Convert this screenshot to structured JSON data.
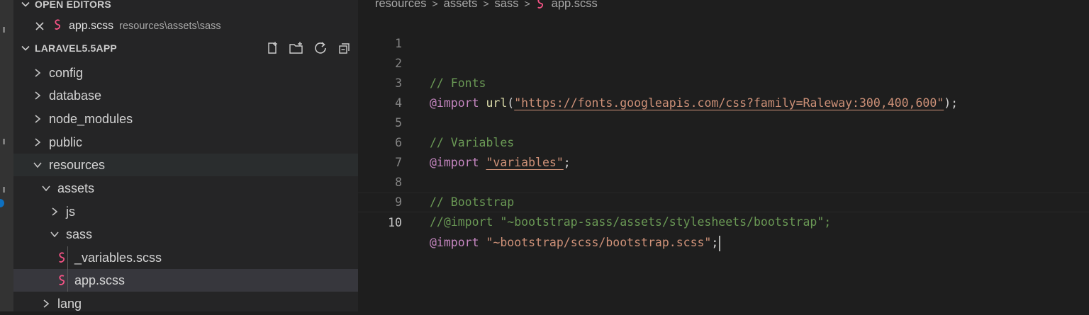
{
  "open_editors": {
    "header": "OPEN EDITORS",
    "items": [
      {
        "name": "app.scss",
        "path": "resources\\assets\\sass"
      }
    ]
  },
  "project": {
    "name": "LARAVEL5.5APP",
    "actions": [
      "new-file-icon",
      "new-folder-icon",
      "refresh-icon",
      "collapse-all-icon"
    ]
  },
  "tree": {
    "config": "config",
    "database": "database",
    "node_modules": "node_modules",
    "public": "public",
    "resources": "resources",
    "assets": "assets",
    "js": "js",
    "sass": "sass",
    "variables_file": "_variables.scss",
    "app_file": "app.scss",
    "lang": "lang"
  },
  "breadcrumb": {
    "parts": [
      "resources",
      "assets",
      "sass"
    ],
    "file": "app.scss"
  },
  "editor": {
    "line_numbers": [
      "1",
      "2",
      "3",
      "4",
      "5",
      "6",
      "7",
      "8",
      "9",
      "10"
    ],
    "lines": {
      "l2_comment": "// Fonts",
      "l3_at": "@import",
      "l3_fn": "url",
      "l3_open": "(",
      "l3_str": "\"https://fonts.googleapis.com/css?family=Raleway:300,400,600\"",
      "l3_close": ");",
      "l5_comment": "// Variables",
      "l6_at": "@import",
      "l6_str": "\"variables\"",
      "l6_end": ";",
      "l8_comment": "// Bootstrap",
      "l9_comment": "//@import \"~bootstrap-sass/assets/stylesheets/bootstrap\";",
      "l10_at": "@import",
      "l10_str": "\"~bootstrap/scss/bootstrap.scss\"",
      "l10_end": ";"
    }
  },
  "colors": {
    "sidebar_bg": "#252526",
    "editor_bg": "#1e1e1e",
    "comment": "#6a9955",
    "keyword": "#c586c0",
    "string": "#ce9178",
    "function": "#dcdcaa",
    "sass_icon": "#f55385"
  }
}
